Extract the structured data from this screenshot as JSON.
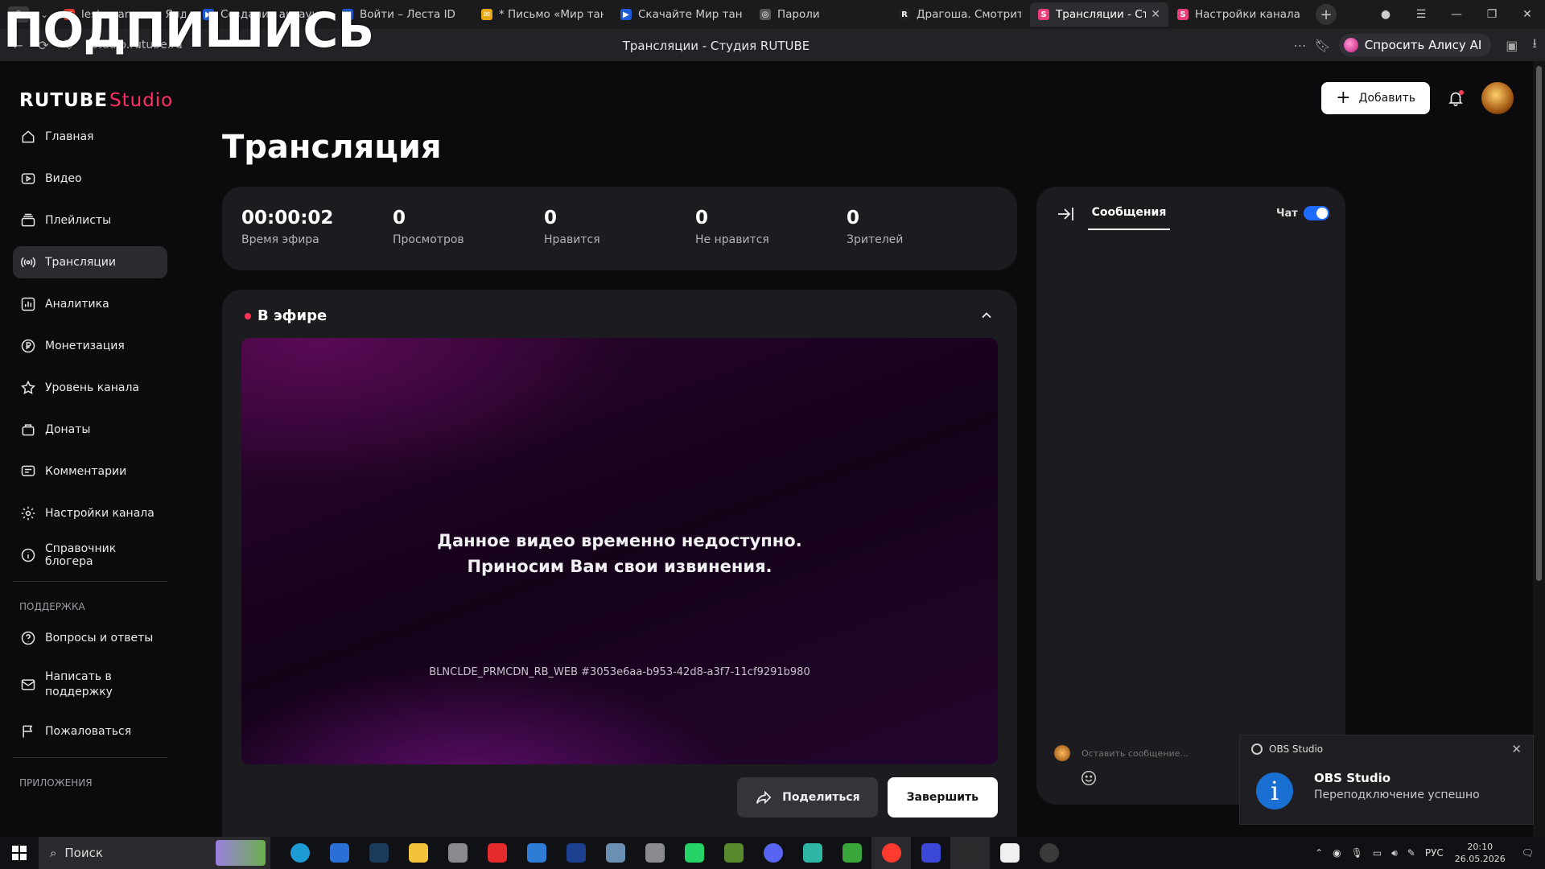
{
  "browser": {
    "tab_count": "9",
    "tabs": [
      {
        "title": "lesta games — Яндекс",
        "color": "#e63a2e",
        "glyph": "Я"
      },
      {
        "title": "Создание аккаунта |",
        "color": "#1e5bd6",
        "glyph": "▶"
      },
      {
        "title": "Войти – Леста ID",
        "color": "#1e5bd6",
        "glyph": "▶"
      },
      {
        "title": "* Письмо «Мир танков",
        "color": "#e6a817",
        "glyph": "✉"
      },
      {
        "title": "Скачайте Мир танков",
        "color": "#1e5bd6",
        "glyph": "▶"
      },
      {
        "title": "Пароли",
        "color": "#555555",
        "glyph": "◎"
      },
      {
        "title": "Драгоша. Смотрите",
        "color": "#222222",
        "glyph": "R"
      },
      {
        "title": "Трансляции - Студи",
        "color": "#e83e7a",
        "glyph": "S"
      },
      {
        "title": "Настройки канала -",
        "color": "#e83e7a",
        "glyph": "S"
      }
    ],
    "url": "studio.rutube.ru",
    "page_title": "Трансляции - Студия RUTUBE",
    "alice_label": "Спросить Алису AI"
  },
  "overlay_text": "ПОДПИШИСЬ",
  "app": {
    "logo_main": "RUTUBE",
    "logo_sub": "Studio",
    "add_button": "Добавить",
    "heading": "Трансляция"
  },
  "sidebar": {
    "items": [
      {
        "label": "Главная",
        "icon": "home-icon"
      },
      {
        "label": "Видео",
        "icon": "video-icon"
      },
      {
        "label": "Плейлисты",
        "icon": "playlist-icon"
      },
      {
        "label": "Трансляции",
        "icon": "broadcast-icon",
        "active": true
      },
      {
        "label": "Аналитика",
        "icon": "analytics-icon"
      },
      {
        "label": "Монетизация",
        "icon": "ruble-icon"
      },
      {
        "label": "Уровень канала",
        "icon": "star-icon"
      },
      {
        "label": "Донаты",
        "icon": "bag-icon"
      },
      {
        "label": "Комментарии",
        "icon": "comment-icon"
      },
      {
        "label": "Настройки канала",
        "icon": "gear-icon"
      },
      {
        "label": "Справочник блогера",
        "icon": "info-icon"
      }
    ],
    "support_section": "ПОДДЕРЖКА",
    "support_items": [
      {
        "label": "Вопросы и ответы",
        "icon": "question-icon"
      },
      {
        "label": "Написать в поддержку",
        "icon": "mail-icon"
      },
      {
        "label": "Пожаловаться",
        "icon": "flag-icon"
      }
    ],
    "apps_section": "ПРИЛОЖЕНИЯ"
  },
  "stats": [
    {
      "value": "00:00:02",
      "label": "Время эфира"
    },
    {
      "value": "0",
      "label": "Просмотров"
    },
    {
      "value": "0",
      "label": "Нравится"
    },
    {
      "value": "0",
      "label": "Не нравится"
    },
    {
      "value": "0",
      "label": "Зрителей"
    }
  ],
  "live": {
    "title": "В эфире",
    "message_line1": "Данное видео временно недоступно.",
    "message_line2": "Приносим Вам свои извинения.",
    "error_code": "BLNCLDE_PRMCDN_RB_WEB #3053e6aa-b953-42d8-a3f7-11cf9291b980",
    "share_button": "Поделиться",
    "end_button": "Завершить"
  },
  "chat": {
    "tab_messages": "Сообщения",
    "toggle_label": "Чат",
    "toggle_on": true,
    "input_placeholder": "Оставить сообщение..."
  },
  "toast": {
    "app_name": "OBS Studio",
    "title": "OBS Studio",
    "text": "Переподключение успешно"
  },
  "taskbar": {
    "search_placeholder": "Поиск",
    "lang": "РУС",
    "time": "20:10",
    "date": "26.05.2026"
  }
}
